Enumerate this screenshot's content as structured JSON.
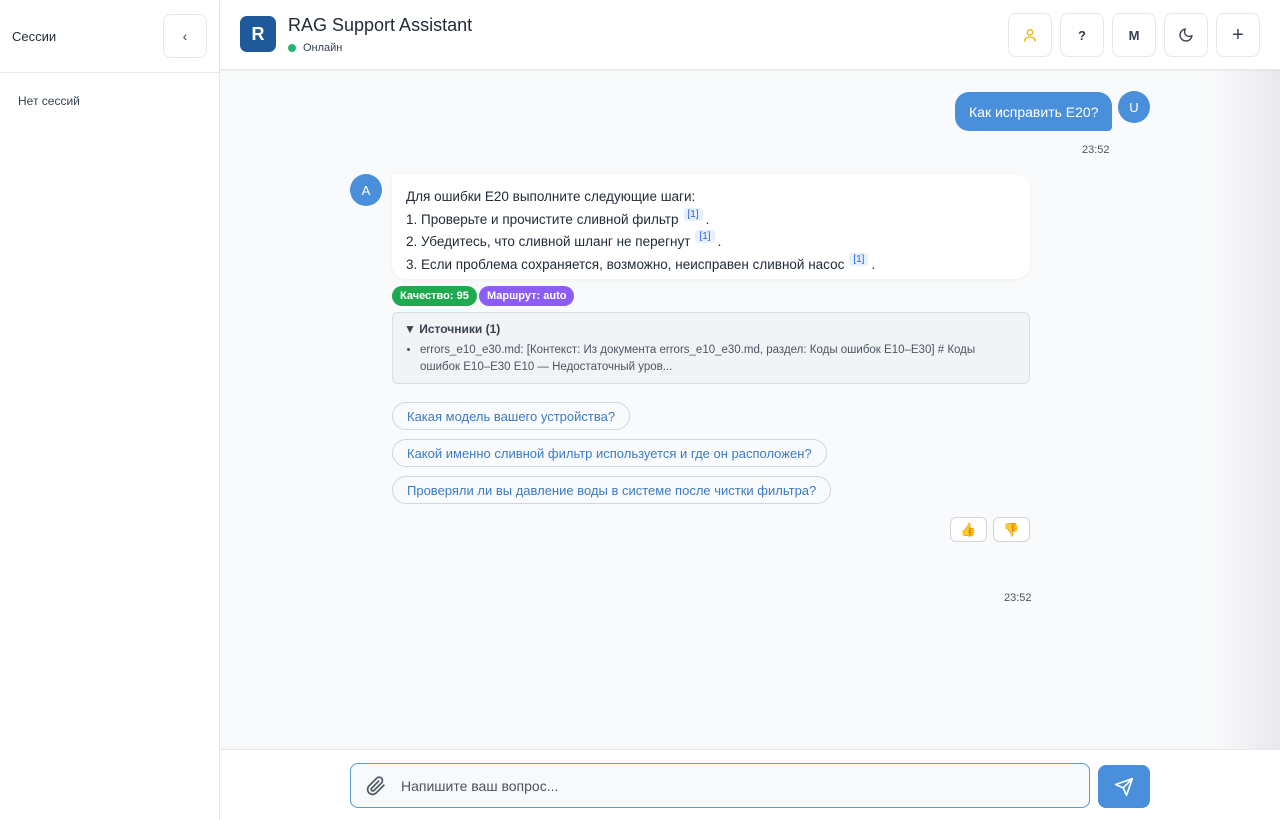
{
  "sidebar": {
    "title": "Сессии",
    "collapse_label": "‹",
    "empty_text": "Нет сессий"
  },
  "header": {
    "logo_letter": "R",
    "title": "RAG Support Assistant",
    "status": "Онлайн",
    "buttons": {
      "user_icon": "user-icon",
      "help_label": "?",
      "mode_label": "M",
      "theme_icon": "moon-icon",
      "new_label": "+"
    }
  },
  "colors": {
    "accent": "#4a8fdb",
    "logo": "#1e5a9a",
    "online": "#22b573",
    "quality_badge": "#1faa50",
    "route_badge": "#8b5cf6"
  },
  "messages": {
    "user": {
      "avatar": "U",
      "text": "Как исправить E20?",
      "time": "23:52"
    },
    "assistant": {
      "avatar": "A",
      "intro": "Для ошибки E20 выполните следующие шаги:",
      "steps": [
        {
          "text": "1. Проверьте и прочистите сливной фильтр",
          "cite": "[1]",
          "end": "."
        },
        {
          "text": "2. Убедитесь, что сливной шланг не перегнут",
          "cite": "[1]",
          "end": "."
        },
        {
          "text": "3. Если проблема сохраняется, возможно, неисправен сливной насос",
          "cite": "[1]",
          "end": "."
        }
      ],
      "badges": {
        "quality": "Качество: 95",
        "route": "Маршрут: auto"
      },
      "sources": {
        "title": "▼ Источники (1)",
        "items": [
          "errors_e10_e30.md: [Контекст: Из документа errors_e10_e30.md, раздел: Коды ошибок E10–E30] # Коды ошибок E10–E30 E10 — Недостаточный уров..."
        ]
      },
      "suggestions": [
        "Какая модель вашего устройства?",
        "Какой именно сливной фильтр используется и где он расположен?",
        "Проверяли ли вы давление воды в системе после чистки фильтра?"
      ],
      "reactions": {
        "up": "👍",
        "down": "👎"
      },
      "time": "23:52"
    }
  },
  "input": {
    "placeholder": "Напишите ваш вопрос..."
  }
}
